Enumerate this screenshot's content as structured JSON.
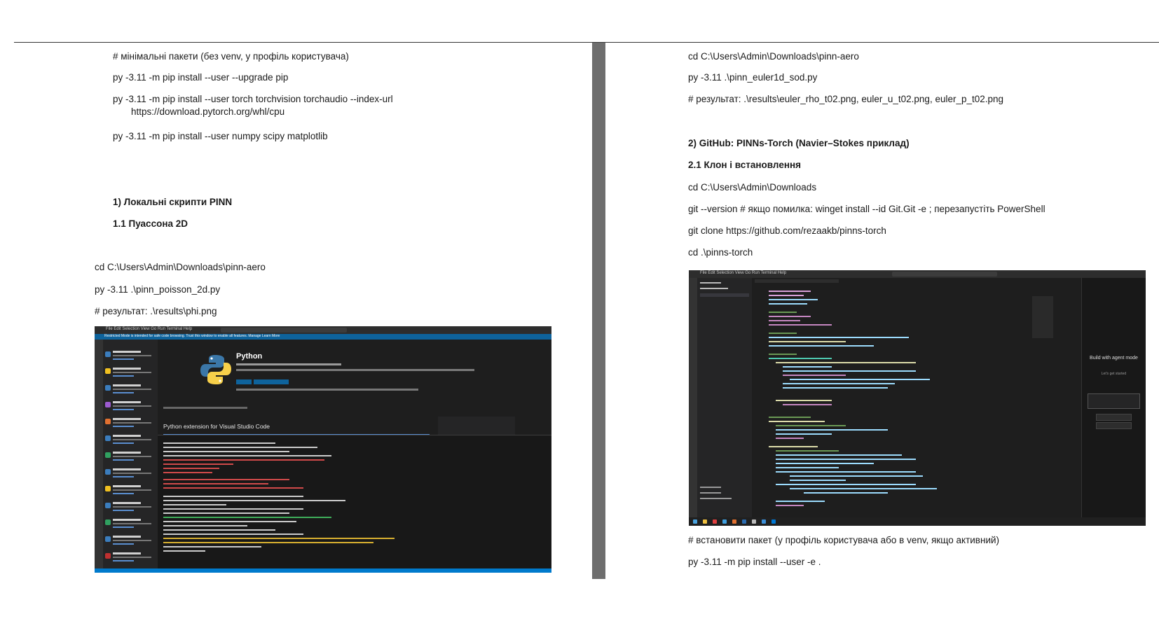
{
  "left_column": {
    "line1": "# мінімальні пакети (без venv, у профіль користувача)",
    "line2": "py -3.11 -m pip install --user --upgrade pip",
    "line3a": "py -3.11 -m pip install --user torch torchvision torchaudio --index-url",
    "line3b": "https://download.pytorch.org/whl/cpu",
    "line4": "py -3.11 -m pip install --user numpy scipy matplotlib",
    "heading1": "1) Локальні скрипти PINN",
    "heading1_1": "1.1 Пуассона 2D",
    "line5": "cd C:\\Users\\Admin\\Downloads\\pinn-aero",
    "line6": "py -3.11 .\\pinn_poisson_2d.py",
    "line7": "# результат: .\\results\\phi.png"
  },
  "right_column": {
    "line1": "cd C:\\Users\\Admin\\Downloads\\pinn-aero",
    "line2": "py -3.11 .\\pinn_euler1d_sod.py",
    "line3": "# результат: .\\results\\euler_rho_t02.png, euler_u_t02.png, euler_p_t02.png",
    "heading2": "2) GitHub: PINNs-Torch (Navier–Stokes приклад)",
    "heading2_1": "2.1 Клон і встановлення",
    "line4": "cd C:\\Users\\Admin\\Downloads",
    "line5": "git --version   # якщо помилка: winget install --id Git.Git -e ; перезапустіть PowerShell",
    "line6": "git clone https://github.com/rezaakb/pinns-torch",
    "line7": "cd .\\pinns-torch",
    "line8": "# встановити пакет (у профіль користувача або в venv, якщо активний)",
    "line9": "py -3.11 -m pip install --user -e ."
  },
  "screenshot1": {
    "menu": "File  Edit  Selection  View  Go  Run  Terminal  Help",
    "banner": "Restricted Mode is intended for safe code browsing. Trust this window to enable all features.  Manage  Learn More",
    "ext_name": "Python",
    "ext_heading": "Python extension for Visual Studio Code"
  },
  "screenshot2": {
    "menu": "File  Edit  Selection  View  Go  Run  Terminal  Help",
    "chat_title": "Build with agent mode",
    "chat_sub": "Let's get started"
  },
  "colors": {
    "vscode_bg": "#1e1e1e",
    "vscode_blue": "#007acc",
    "page_divider": "#6e6e6e"
  }
}
